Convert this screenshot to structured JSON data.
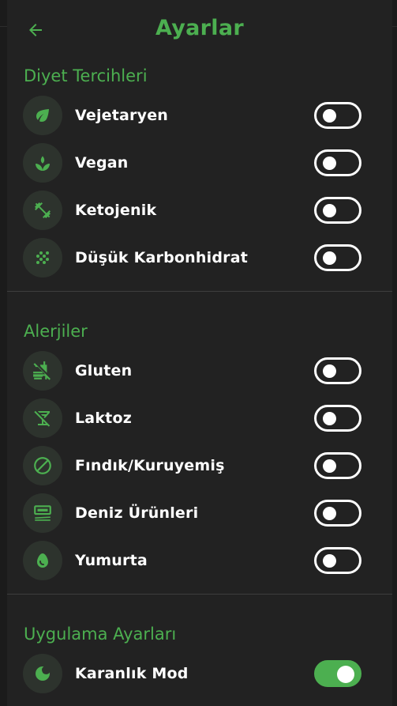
{
  "header": {
    "title": "Ayarlar",
    "back_icon": "arrow-left-icon"
  },
  "colors": {
    "accent": "#4caf50",
    "panel_bg": "#222222",
    "icon_bg": "#2d332d",
    "text": "#ffffff"
  },
  "diet": {
    "title": "Diyet Tercihleri",
    "items": [
      {
        "label": "Vejetaryen",
        "icon": "leaf-icon",
        "enabled": false
      },
      {
        "label": "Vegan",
        "icon": "sprout-icon",
        "enabled": false
      },
      {
        "label": "Ketojenik",
        "icon": "dumbbell-icon",
        "enabled": false
      },
      {
        "label": "Düşük Karbonhidrat",
        "icon": "grain-icon",
        "enabled": false
      }
    ]
  },
  "allergies": {
    "title": "Alerjiler",
    "items": [
      {
        "label": "Gluten",
        "icon": "no-food-icon",
        "enabled": false
      },
      {
        "label": "Laktoz",
        "icon": "no-drinks-icon",
        "enabled": false
      },
      {
        "label": "Fındık/Kuruyemiş",
        "icon": "block-icon",
        "enabled": false
      },
      {
        "label": "Deniz Ürünleri",
        "icon": "set-meal-icon",
        "enabled": false
      },
      {
        "label": "Yumurta",
        "icon": "egg-icon",
        "enabled": false
      }
    ]
  },
  "app_settings": {
    "title": "Uygulama Ayarları",
    "items": [
      {
        "label": "Karanlık Mod",
        "icon": "moon-icon",
        "enabled": true
      }
    ]
  }
}
